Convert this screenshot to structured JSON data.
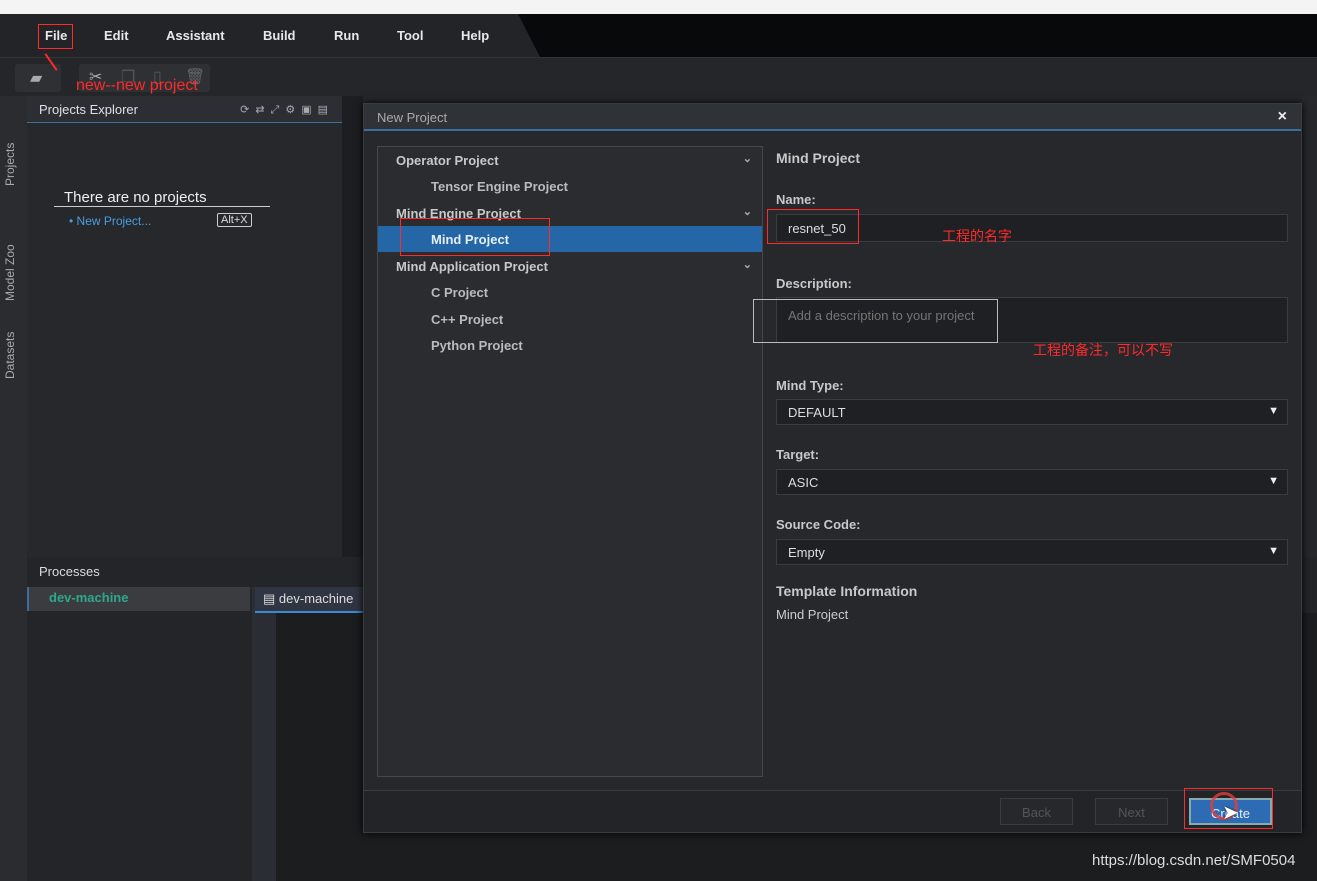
{
  "menu": [
    "File",
    "Edit",
    "Assistant",
    "Build",
    "Run",
    "Tool",
    "Help"
  ],
  "sidetabs": [
    "Projects",
    "Model Zoo",
    "Datasets"
  ],
  "explorer": {
    "title": "Projects Explorer",
    "empty": "There are no projects",
    "new_link": "New Project...",
    "shortcut": "Alt+X"
  },
  "processes": {
    "title": "Processes",
    "machine": "dev-machine",
    "tab": "dev-machine"
  },
  "dialog": {
    "title": "New Project",
    "close": "×",
    "items": [
      {
        "label": "Operator Project",
        "type": "group"
      },
      {
        "label": "Tensor Engine Project",
        "type": "sub"
      },
      {
        "label": "Mind Engine Project",
        "type": "group"
      },
      {
        "label": "Mind Project",
        "type": "sub",
        "selected": true
      },
      {
        "label": "Mind Application Project",
        "type": "group"
      },
      {
        "label": "C Project",
        "type": "sub"
      },
      {
        "label": "C++ Project",
        "type": "sub"
      },
      {
        "label": "Python Project",
        "type": "sub"
      }
    ],
    "form_title": "Mind Project",
    "name_label": "Name:",
    "name_value": "resnet_50",
    "desc_label": "Description:",
    "desc_placeholder": "Add a description to your project",
    "mind_type_label": "Mind Type:",
    "mind_type": "DEFAULT",
    "target_label": "Target:",
    "target": "ASIC",
    "source_label": "Source Code:",
    "source": "Empty",
    "template_label": "Template Information",
    "template_value": "Mind Project",
    "back": "Back",
    "next": "Next",
    "create": "Create"
  },
  "annotations": {
    "new": "new--new project",
    "name": "工程的名字",
    "desc": "工程的备注，可以不写"
  },
  "watermark": "https://blog.csdn.net/SMF0504",
  "colors": {
    "accent": "#2566a6",
    "annotation": "#ff2a2a",
    "machine": "#2fa88a"
  }
}
